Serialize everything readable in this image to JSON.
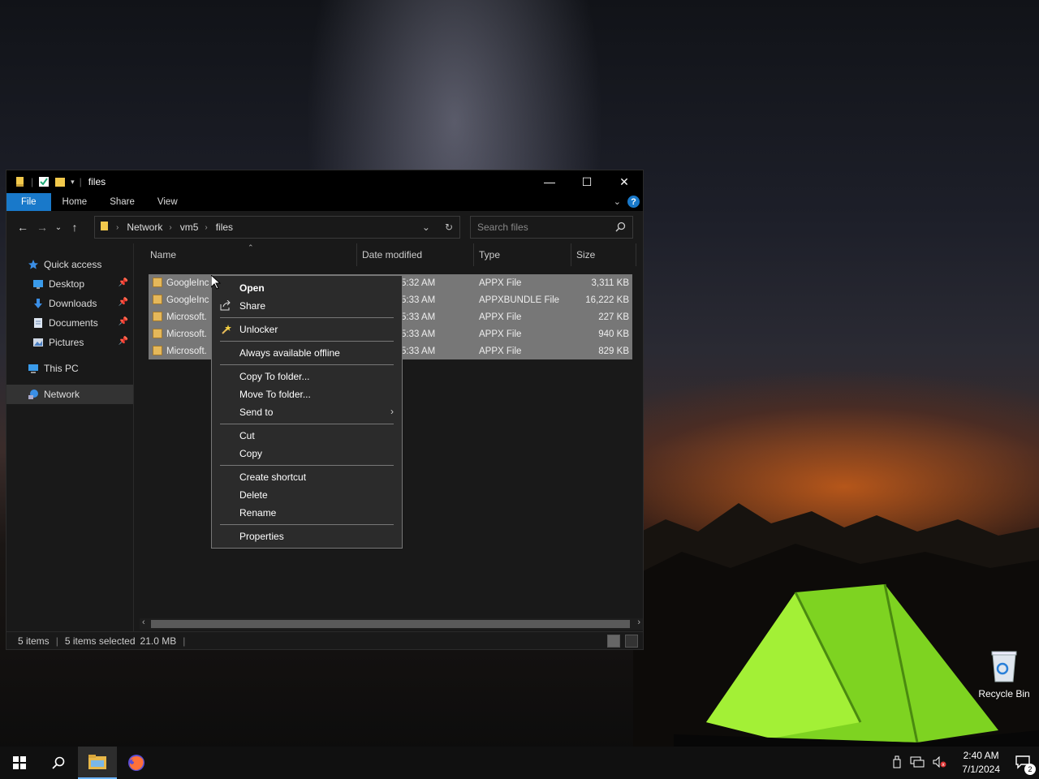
{
  "window": {
    "title": "files",
    "controls": {
      "minimize": "—",
      "maximize": "☐",
      "close": "✕"
    }
  },
  "ribbon": {
    "tabs": [
      "File",
      "Home",
      "Share",
      "View"
    ],
    "help": "?"
  },
  "address": {
    "crumbs": [
      "Network",
      "vm5",
      "files"
    ]
  },
  "search": {
    "placeholder": "Search files"
  },
  "sidebar": {
    "items": [
      {
        "label": "Quick access",
        "icon": "star-icon"
      },
      {
        "label": "Desktop",
        "icon": "desktop-icon",
        "pinned": true
      },
      {
        "label": "Downloads",
        "icon": "download-icon",
        "pinned": true
      },
      {
        "label": "Documents",
        "icon": "document-icon",
        "pinned": true
      },
      {
        "label": "Pictures",
        "icon": "pictures-icon",
        "pinned": true
      },
      {
        "label": "This PC",
        "icon": "pc-icon"
      },
      {
        "label": "Network",
        "icon": "network-icon",
        "selected": true
      }
    ]
  },
  "columns": {
    "name": "Name",
    "date": "Date modified",
    "type": "Type",
    "size": "Size"
  },
  "files": [
    {
      "name": "GoogleInc",
      "date": "5:32 AM",
      "type": "APPX File",
      "size": "3,311 KB"
    },
    {
      "name": "GoogleInc",
      "date": "5:33 AM",
      "type": "APPXBUNDLE File",
      "size": "16,222 KB"
    },
    {
      "name": "Microsoft.",
      "date": "5:33 AM",
      "type": "APPX File",
      "size": "227 KB"
    },
    {
      "name": "Microsoft.",
      "date": "5:33 AM",
      "type": "APPX File",
      "size": "940 KB"
    },
    {
      "name": "Microsoft.",
      "date": "5:33 AM",
      "type": "APPX File",
      "size": "829 KB"
    }
  ],
  "status": {
    "count": "5 items",
    "selected": "5 items selected",
    "size": "21.0 MB"
  },
  "context_menu": {
    "open": "Open",
    "share": "Share",
    "unlocker": "Unlocker",
    "offline": "Always available offline",
    "copy_to": "Copy To folder...",
    "move_to": "Move To folder...",
    "send_to": "Send to",
    "cut": "Cut",
    "copy": "Copy",
    "shortcut": "Create shortcut",
    "delete": "Delete",
    "rename": "Rename",
    "properties": "Properties"
  },
  "desktop": {
    "recycle_bin": "Recycle Bin"
  },
  "taskbar": {
    "time": "2:40 AM",
    "date": "7/1/2024",
    "notification_count": "2"
  },
  "colors": {
    "accent": "#1979ca",
    "selection": "#777777",
    "menu_bg": "#2b2b2b"
  }
}
